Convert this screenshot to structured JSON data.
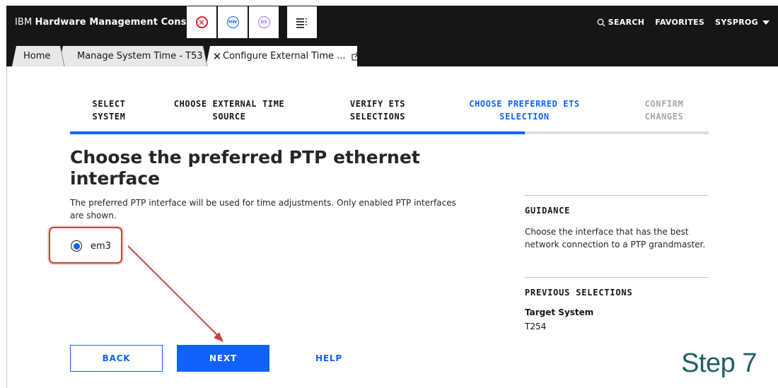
{
  "header": {
    "brand_prefix": "IBM",
    "brand_name": "Hardware Management Console",
    "search_label": "SEARCH",
    "favorites_label": "FAVORITES",
    "user_label": "SYSPROG",
    "hw_label": "HW",
    "ds_label": "DS"
  },
  "tabs": [
    {
      "label": "Home"
    },
    {
      "label": "Manage System Time - T53"
    },
    {
      "label": "Configure External Time ..."
    }
  ],
  "steps": [
    {
      "line1": "SELECT",
      "line2": "SYSTEM"
    },
    {
      "line1": "CHOOSE EXTERNAL TIME",
      "line2": "SOURCE"
    },
    {
      "line1": "VERIFY ETS",
      "line2": "SELECTIONS"
    },
    {
      "line1": "CHOOSE PREFERRED ETS",
      "line2": "SELECTION"
    },
    {
      "line1": "CONFIRM",
      "line2": "CHANGES"
    }
  ],
  "page": {
    "title": "Choose the preferred PTP ethernet interface",
    "description": "The preferred PTP interface will be used for time adjustments. Only enabled PTP interfaces are shown.",
    "option_label": "em3",
    "option_selected": true
  },
  "guidance": {
    "heading": "GUIDANCE",
    "text": "Choose the interface that has the best network connection to a PTP grandmaster.",
    "prev_heading": "PREVIOUS SELECTIONS",
    "target_label": "Target System",
    "target_value": "T254"
  },
  "buttons": {
    "back": "BACK",
    "next": "NEXT",
    "help": "HELP"
  },
  "annotation": {
    "step_text": "Step 7"
  },
  "colors": {
    "accent": "#0f62fe",
    "topbar": "#161616",
    "highlight": "#c0473a",
    "step_note": "#1f5f6b"
  }
}
